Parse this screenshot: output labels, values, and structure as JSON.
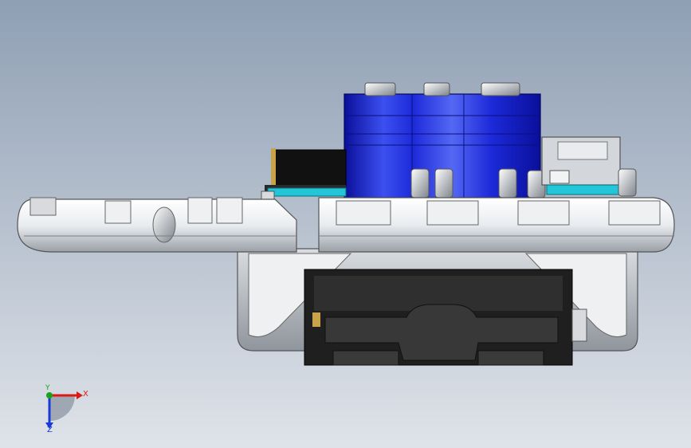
{
  "viewport": {
    "background_top": "#8f9fb4",
    "background_bottom": "#dfe3e9"
  },
  "colors": {
    "servo_blue": "#1c2ad8",
    "servo_blue_light": "#4c62f0",
    "servo_blue_dark": "#0a0f9a",
    "pcb_cyan": "#22c6d8",
    "chassis_white": "#f4f6f8",
    "chassis_gray": "#b7bcc2",
    "battery_black": "#202020",
    "axis_x": "#d81a1a",
    "axis_y": "#1aa31a",
    "axis_z": "#1a3ad8"
  },
  "triad": {
    "x_label": "X",
    "y_label": "Y",
    "z_label": "Z"
  }
}
